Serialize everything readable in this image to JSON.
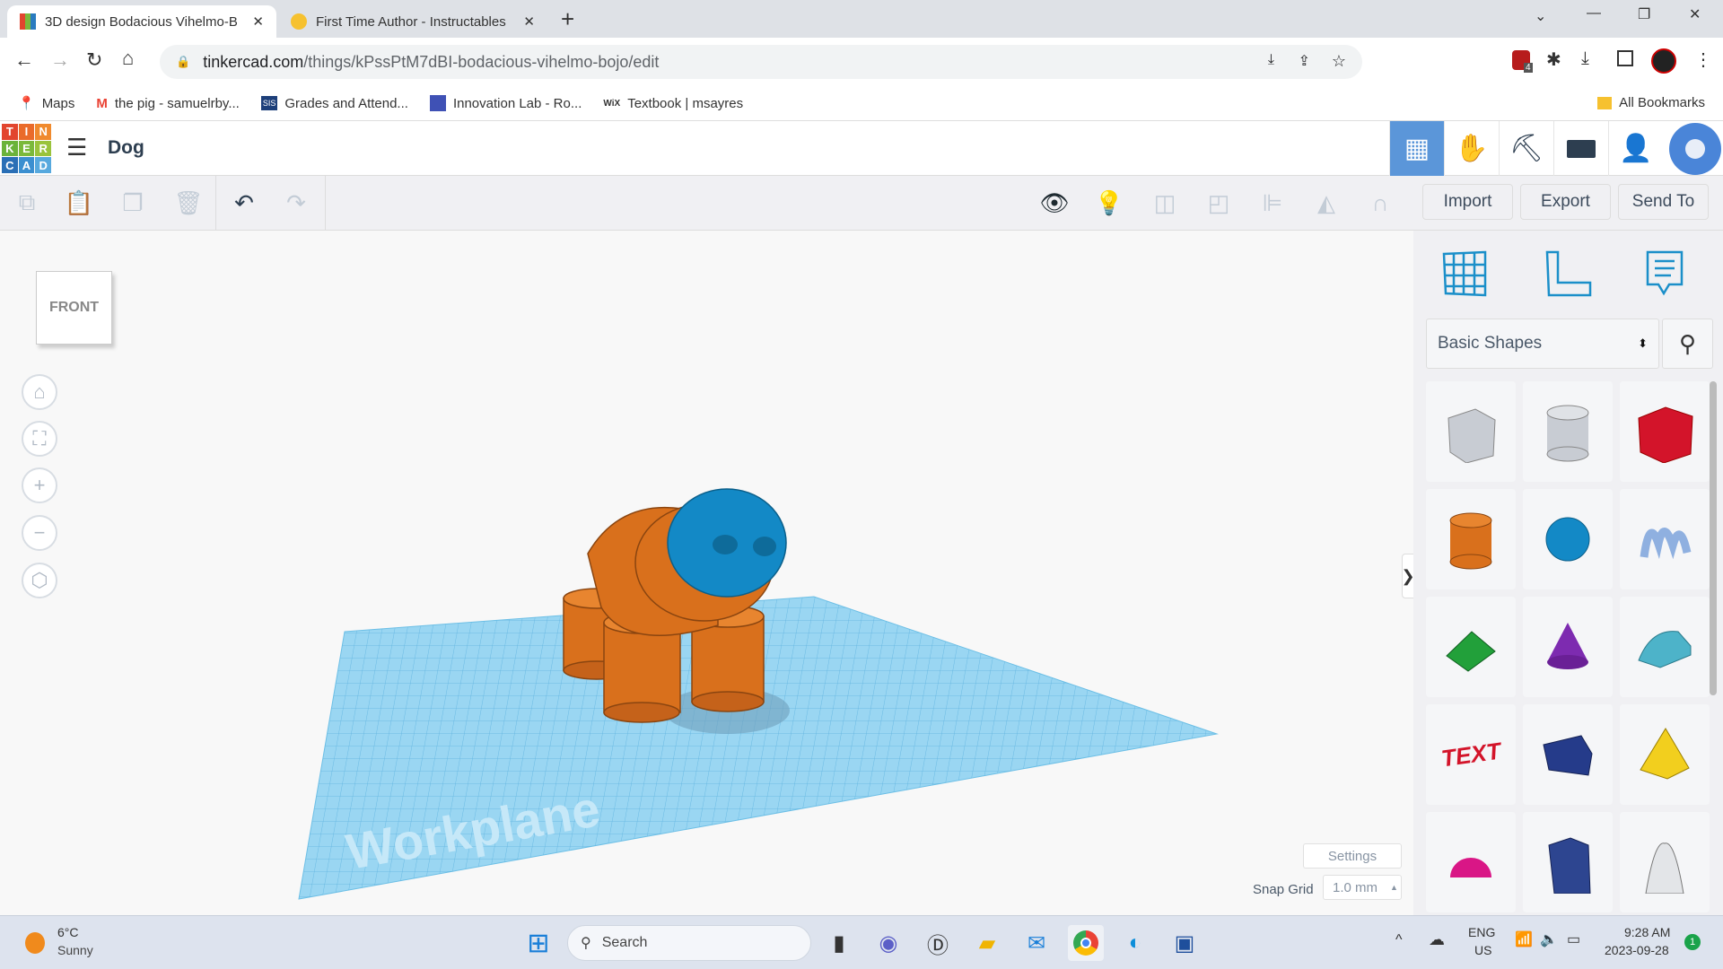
{
  "browser": {
    "tabs": [
      {
        "title": "3D design Bodacious Vihelmo-B",
        "active": true
      },
      {
        "title": "First Time Author - Instructables",
        "active": false
      }
    ],
    "url_host": "tinkercad.com",
    "url_path": "/things/kPssPtM7dBI-bodacious-vihelmo-bojo/edit",
    "bookmarks": [
      {
        "label": "Maps",
        "icon": "maps-icon"
      },
      {
        "label": "the pig - samuelrby...",
        "icon": "gmail-icon"
      },
      {
        "label": "Grades and Attend...",
        "icon": "sis-icon",
        "badge": "SIS"
      },
      {
        "label": "Innovation Lab - Ro...",
        "icon": "forms-icon"
      },
      {
        "label": "Textbook | msayres",
        "icon": "wix-icon",
        "badge": "WiX"
      }
    ],
    "all_bookmarks": "All Bookmarks",
    "extension_badge": "4"
  },
  "app": {
    "logo": [
      "T",
      "I",
      "N",
      "K",
      "E",
      "R",
      "C",
      "A",
      "D"
    ],
    "design_name": "Dog",
    "toolbar": {
      "import": "Import",
      "export": "Export",
      "send_to": "Send To"
    },
    "view_cube": "FRONT",
    "workplane_label": "Workplane",
    "settings": "Settings",
    "snap_grid_label": "Snap Grid",
    "snap_grid_value": "1.0 mm",
    "library": "Basic Shapes",
    "shapes": [
      "box",
      "cylinder-hole",
      "box-red",
      "cylinder",
      "sphere",
      "scribble",
      "roof",
      "cone",
      "round-roof",
      "text",
      "wedge",
      "pyramid",
      "half-sphere",
      "polygon",
      "paraboloid"
    ],
    "text_shape_label": "TEXT"
  },
  "colors": {
    "orange": "#d9701c",
    "blue": "#1389c6",
    "workplane": "#8fd0ee",
    "accent": "#5b96d9"
  },
  "taskbar": {
    "temp": "6°C",
    "weather": "Sunny",
    "search": "Search",
    "lang1": "ENG",
    "lang2": "US",
    "time": "9:28 AM",
    "date": "2023-09-28",
    "notif": "1"
  }
}
